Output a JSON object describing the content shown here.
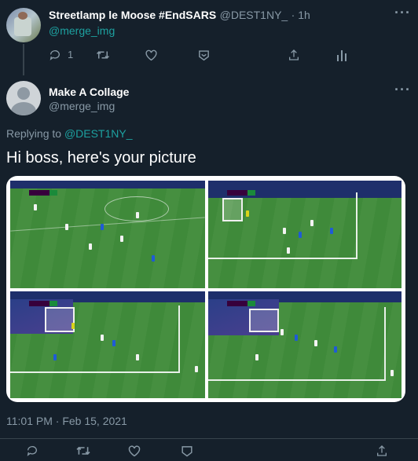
{
  "prev_tweet": {
    "name": "Streetlamp le Moose #EndSARS",
    "handle": "@DEST1NY_",
    "time": "· 1h",
    "reply_text": "@merge_img",
    "reply_count": "1"
  },
  "tweet": {
    "name": "Make A Collage",
    "handle": "@merge_img",
    "replying_prefix": "Replying to",
    "replying_handle": "@DEST1NY_",
    "text": "Hi boss, here's your picture",
    "timestamp": "11:01 PM · Feb 15, 2021"
  },
  "colors": {
    "background": "#15202b",
    "accent": "#1da1a0",
    "muted": "#8899a6",
    "pitch": "#3f8a3a"
  },
  "icons": [
    "reply-icon",
    "retweet-icon",
    "like-icon",
    "thread-icon",
    "share-icon",
    "analytics-icon",
    "more-icon"
  ]
}
